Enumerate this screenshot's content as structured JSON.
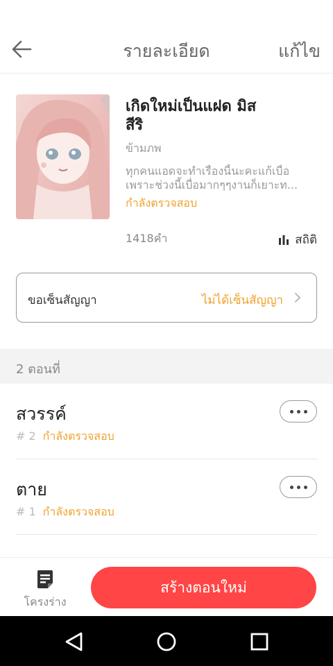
{
  "header": {
    "title": "รายละเอียด",
    "edit_label": "แก้ไข"
  },
  "book": {
    "title": "เกิดใหม่เป็นแฝด มิส สีริ",
    "category": "ข้ามภพ",
    "description": "ทุกคนแอดจะทำเรื่องนี้นะคะแก้เบื่อ เพราะช่วงนี้เบื่อมากๆๆงานก็เยาะท...",
    "status": "กำลังตรวจสอบ",
    "word_count": "1418คำ",
    "stats_label": "สถิติ"
  },
  "contract": {
    "label": "ขอเซ็นสัญญา",
    "value": "ไม่ได้เซ็นสัญญา"
  },
  "chapters_header": "2 ตอนที่",
  "chapters": [
    {
      "title": "สวรรค์",
      "number": "# 2",
      "status": "กำลังตรวจสอบ"
    },
    {
      "title": "ตาย",
      "number": "# 1",
      "status": "กำลังตรวจสอบ"
    }
  ],
  "bottom": {
    "draft_label": "โครงร่าง",
    "create_label": "สร้างตอนใหม่"
  },
  "colors": {
    "accent_orange": "#f0a22c",
    "primary_red": "#ff4545"
  }
}
